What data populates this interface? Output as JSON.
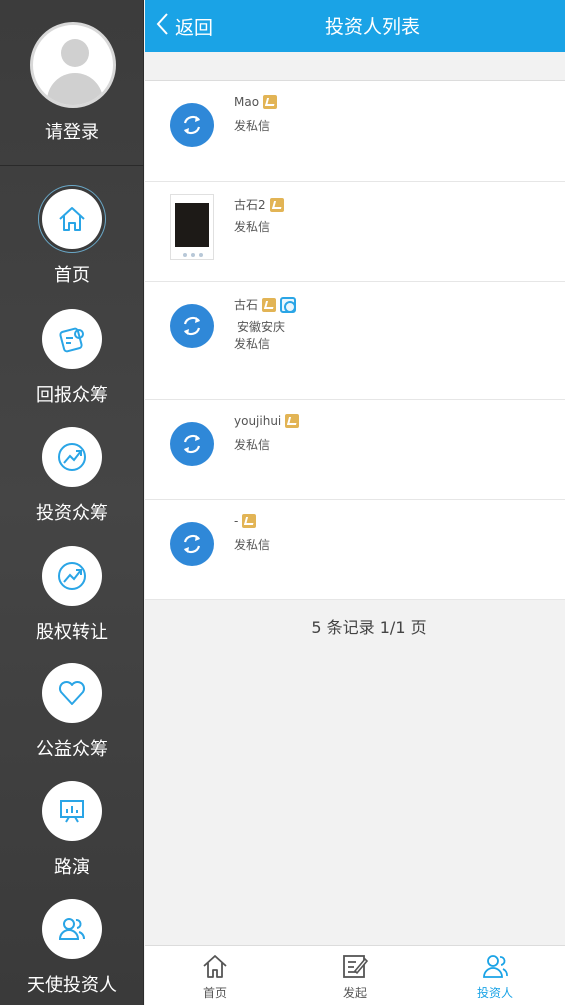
{
  "sidebar": {
    "login_label": "请登录",
    "items": [
      {
        "label": "首页",
        "icon": "home-icon",
        "active": true
      },
      {
        "label": "回报众筹",
        "icon": "return-crowdfunding-icon"
      },
      {
        "label": "投资众筹",
        "icon": "investment-crowdfunding-icon"
      },
      {
        "label": "股权转让",
        "icon": "equity-transfer-icon"
      },
      {
        "label": "公益众筹",
        "icon": "heart-icon"
      },
      {
        "label": "路演",
        "icon": "roadshow-icon"
      },
      {
        "label": "天使投资人",
        "icon": "angel-investor-icon"
      }
    ]
  },
  "header": {
    "back_label": "返回",
    "title": "投资人列表"
  },
  "investors": [
    {
      "name": "Mao",
      "message_label": "发私信"
    },
    {
      "name": "古石2",
      "message_label": "发私信"
    },
    {
      "name": "古石",
      "location": "安徽安庆",
      "message_label": "发私信"
    },
    {
      "name": "youjihui",
      "message_label": "发私信"
    },
    {
      "name": "-",
      "message_label": "发私信"
    }
  ],
  "pager": {
    "text": "5 条记录 1/1 页"
  },
  "tabbar": {
    "tabs": [
      {
        "label": "首页",
        "icon": "home-icon"
      },
      {
        "label": "发起",
        "icon": "edit-icon"
      },
      {
        "label": "投资人",
        "icon": "investors-icon",
        "active": true
      }
    ]
  },
  "colors": {
    "accent": "#1aa3e6",
    "sidebar_bg": "#3f3f3f",
    "icon_blue": "#2f88d8",
    "badge_gold": "#e2b455"
  }
}
